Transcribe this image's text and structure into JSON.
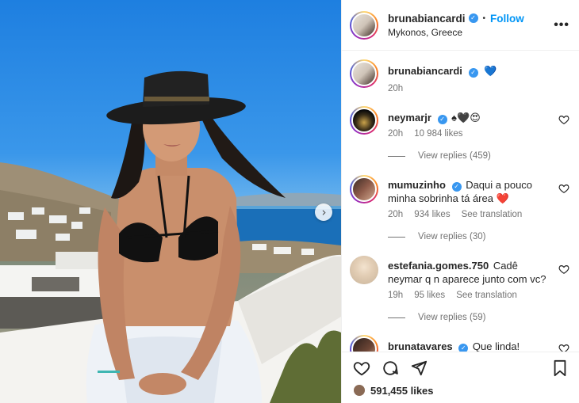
{
  "post": {
    "username": "brunabiancardi",
    "location": "Mykonos, Greece",
    "follow_label": "Follow",
    "dot": "•",
    "more": "•••"
  },
  "caption": {
    "username": "brunabiancardi",
    "text": "💙",
    "time": "20h"
  },
  "comments": [
    {
      "username": "neymarjr",
      "text": "♠🖤😍",
      "time": "20h",
      "likes": "10 984 likes",
      "translate": "",
      "replies": "View replies (459)"
    },
    {
      "username": "mumuzinho",
      "text": "Daqui a pouco minha sobrinha tá área ❤️",
      "time": "20h",
      "likes": "934 likes",
      "translate": "See translation",
      "replies": "View replies (30)"
    },
    {
      "username": "estefania.gomes.750",
      "text": "Cadê neymar q n aparece junto com vc?",
      "time": "19h",
      "likes": "95 likes",
      "translate": "See translation",
      "replies": "View replies (59)"
    },
    {
      "username": "brunatavares",
      "text": "Que linda!",
      "time": "",
      "likes": "",
      "translate": "",
      "replies": ""
    }
  ],
  "footer": {
    "likes": "591,455 likes"
  },
  "icons": {
    "verified": "✓",
    "next": "›"
  },
  "colors": {
    "accent": "#0095f6",
    "verified": "#3897f0",
    "heart_red": "#e0245e"
  }
}
